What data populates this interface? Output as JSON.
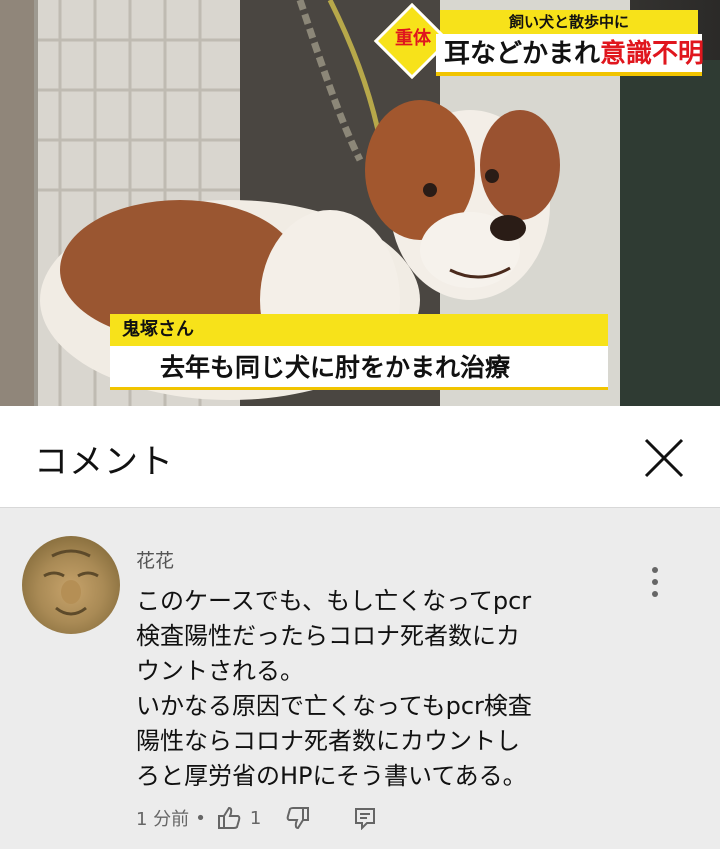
{
  "video": {
    "top_tag": "飼い犬と散歩中に",
    "badge": "重体",
    "headline_black": "耳などかまれ",
    "headline_red": "意識不明",
    "speaker": "鬼塚さん",
    "subtitle": "去年も同じ犬に肘をかまれ治療"
  },
  "comments_panel": {
    "title": "コメント",
    "close_icon": "close-x-icon"
  },
  "comment": {
    "author": "花花",
    "text": "このケースでも、もし亡くなってpcr\n検査陽性だったらコロナ死者数にカ\nウントされる。\nいかなる原因で亡くなってもpcr検査\n陽性ならコロナ死者数にカウントし\nろと厚労省のHPにそう書いてある。",
    "time": "1 分前",
    "separator": "•",
    "like_count": "1",
    "icons": [
      "thumbs-up-icon",
      "thumbs-down-icon",
      "reply-icon",
      "more-vert-icon"
    ]
  },
  "colors": {
    "caption_yellow": "#f7e21a",
    "headline_red": "#e0161d",
    "panel_bg": "#ececec"
  }
}
